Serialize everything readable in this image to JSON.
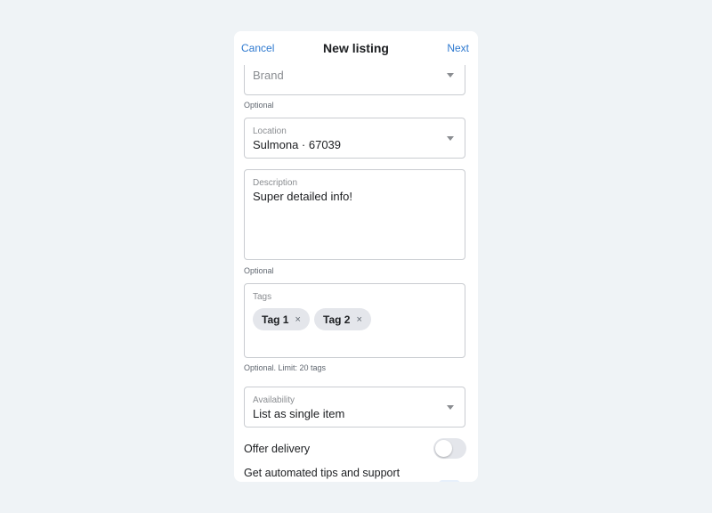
{
  "header": {
    "cancel_label": "Cancel",
    "title": "New listing",
    "next_label": "Next"
  },
  "brand": {
    "placeholder": "Brand",
    "hint": "Optional"
  },
  "location": {
    "label": "Location",
    "value": "Sulmona · 67039"
  },
  "description": {
    "label": "Description",
    "value": "Super detailed info!",
    "hint": "Optional"
  },
  "tags": {
    "label": "Tags",
    "items": [
      {
        "label": "Tag 1",
        "remove": "×"
      },
      {
        "label": "Tag 2",
        "remove": "×"
      }
    ],
    "hint": "Optional. Limit: 20 tags"
  },
  "availability": {
    "label": "Availability",
    "value": "List as single item"
  },
  "offer_delivery": {
    "label": "Offer delivery",
    "enabled": false
  },
  "automated_tips": {
    "label": "Get automated tips and support"
  },
  "icons": {
    "dropdown": "chevron-down-icon",
    "remove": "close-icon"
  },
  "colors": {
    "accent": "#2f7ad0",
    "background": "#eff3f6",
    "chip": "#e4e6eb",
    "border": "#c9ccd1"
  }
}
